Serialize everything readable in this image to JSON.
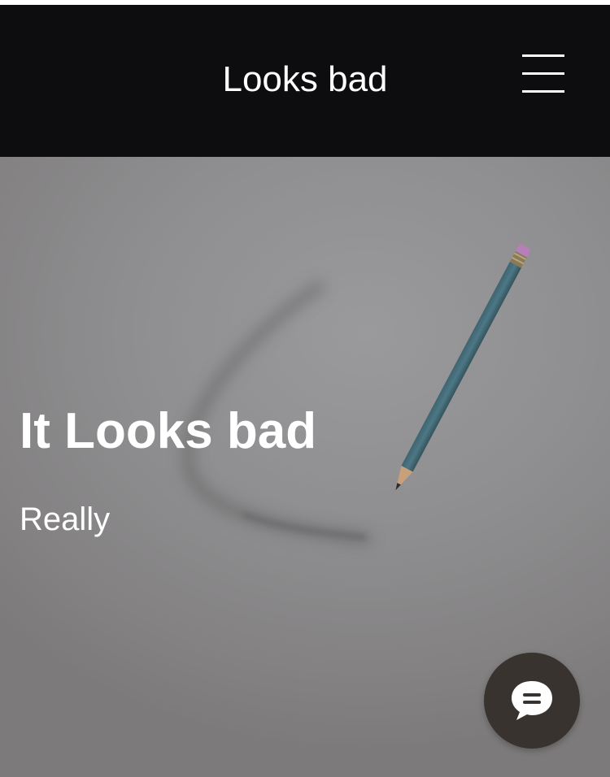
{
  "header": {
    "site_title": "Looks bad",
    "menu_icon": "hamburger-menu-icon",
    "background_color": "#0d0d0f"
  },
  "hero": {
    "heading": "It Looks bad",
    "subtext": "Really",
    "image_subject": "pencil-drawing-line-icon"
  },
  "chat": {
    "icon": "chat-bubble-icon",
    "background_color": "#39332f"
  }
}
